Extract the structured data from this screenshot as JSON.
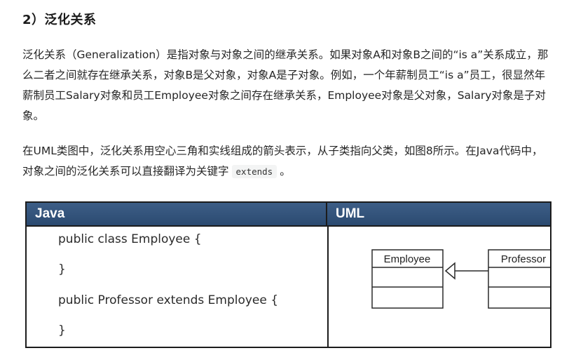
{
  "heading": "2）泛化关系",
  "paragraph1": "泛化关系（Generalization）是指对象与对象之间的继承关系。如果对象A和对象B之间的“is a”关系成立，那么二者之间就存在继承关系，对象B是父对象，对象A是子对象。例如，一个年薪制员工“is a”员工，很显然年薪制员工Salary对象和员工Employee对象之间存在继承关系，Employee对象是父对象，Salary对象是子对象。",
  "paragraph2": {
    "before": "在UML类图中，泛化关系用空心三角和实线组成的箭头表示，从子类指向父类，如图8所示。在Java代码中，对象之间的泛化关系可以直接翻译为关键字",
    "code": "extends",
    "after": "。"
  },
  "table": {
    "header_java": "Java",
    "header_uml": "UML",
    "code_lines": [
      "public class Employee {",
      "}",
      "public Professor extends Employee {",
      "}"
    ],
    "uml": {
      "parent_class": "Employee",
      "child_class": "Professor"
    }
  },
  "colors": {
    "header_bg": "#34557d",
    "border": "#1c1c1c"
  }
}
